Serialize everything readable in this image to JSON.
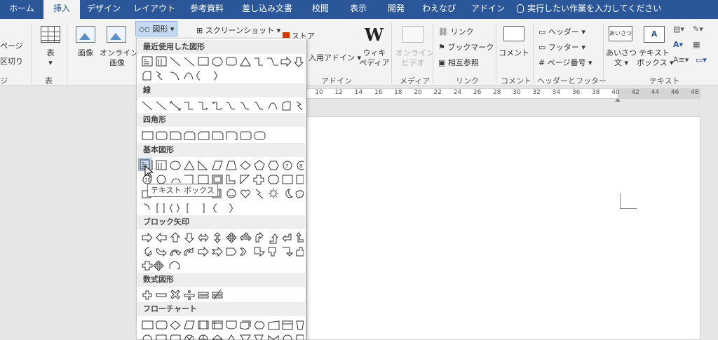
{
  "tabs": [
    {
      "label": "ホーム",
      "name": "tab-home"
    },
    {
      "label": "挿入",
      "name": "tab-insert",
      "active": true
    },
    {
      "label": "デザイン",
      "name": "tab-design"
    },
    {
      "label": "レイアウト",
      "name": "tab-layout"
    },
    {
      "label": "参考資料",
      "name": "tab-references"
    },
    {
      "label": "差し込み文書",
      "name": "tab-mailings"
    },
    {
      "label": "校閲",
      "name": "tab-review"
    },
    {
      "label": "表示",
      "name": "tab-view"
    },
    {
      "label": "開発",
      "name": "tab-developer"
    },
    {
      "label": "わえなび",
      "name": "tab-waenavi"
    },
    {
      "label": "アドイン",
      "name": "tab-addins"
    }
  ],
  "tell_me": "実行したい作業を入力してください",
  "ribbon": {
    "page_label": "ページ",
    "break_label": "区切り",
    "pages_group_tail": "ジ",
    "table_label": "表",
    "table_group": "表",
    "picture_label": "画像",
    "online_picture_label_1": "オンライン",
    "online_picture_label_2": "画像",
    "shapes_label": "図形",
    "screenshot_label": "スクリーンショット",
    "store_label": "ストア",
    "my_addins_label": "入用アドイン",
    "wiki_label_1": "ウィキ",
    "wiki_label_2": "ペディア",
    "addins_group": "アドイン",
    "online_video_label_1": "オンライン",
    "online_video_label_2": "ビデオ",
    "media_group": "メディア",
    "link_label": "リンク",
    "bookmark_label": "ブックマーク",
    "crossref_label": "相互参照",
    "links_group": "リンク",
    "comment_label": "コメント",
    "comment_group": "コメント",
    "header_label": "ヘッダー",
    "footer_label": "フッター",
    "pagenum_label": "ページ番号",
    "hf_group": "ヘッダーとフッター",
    "greeting_label_1": "あいさつ",
    "greeting_label_2": "文",
    "textbox_label_1": "テキスト",
    "textbox_label_2": "ボックス",
    "text_group": "テキスト",
    "greeting_icon_text": "あいさつ",
    "textbox_icon_text": "A"
  },
  "ruler": {
    "numbers": [
      "10",
      "12",
      "14",
      "16",
      "18",
      "20",
      "22",
      "24",
      "26",
      "28",
      "30",
      "32",
      "34",
      "36",
      "38",
      "40",
      "42",
      "44",
      "46",
      "48"
    ]
  },
  "shapes_menu": {
    "sections": {
      "recent": "最近使用した図形",
      "lines": "線",
      "rectangles": "四角形",
      "basic": "基本図形",
      "block_arrows": "ブロック矢印",
      "equation": "数式図形",
      "flowchart": "フローチャート"
    },
    "tooltip": "テキスト ボックス"
  }
}
